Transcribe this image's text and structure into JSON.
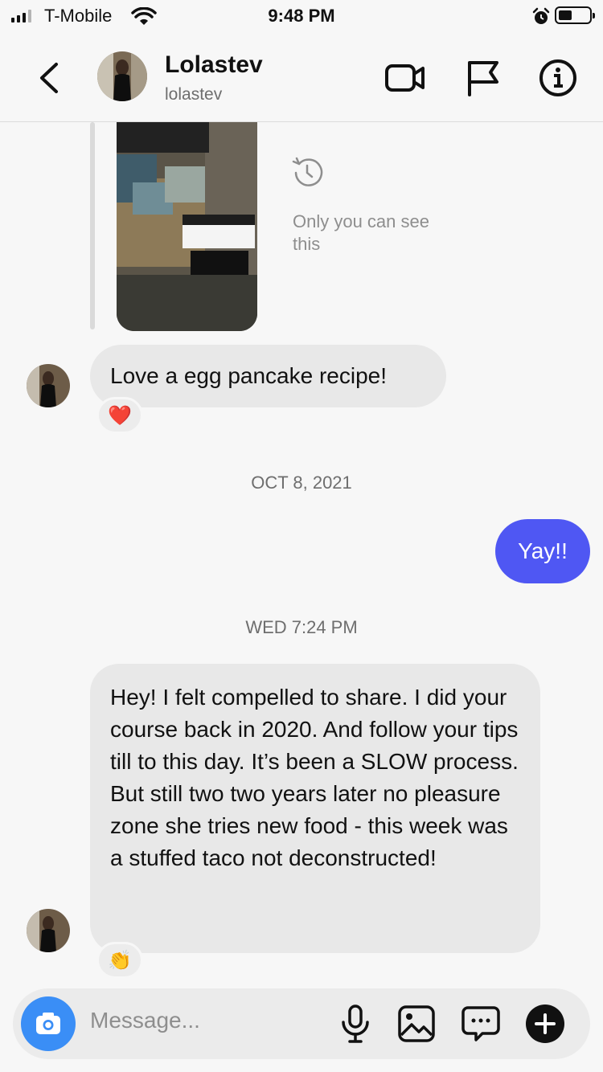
{
  "status_bar": {
    "carrier": "T-Mobile",
    "time": "9:48 PM",
    "icons": [
      "signal-icon",
      "wifi-icon",
      "alarm-icon",
      "battery-icon"
    ]
  },
  "header": {
    "name": "Lolastev",
    "username": "lolastev",
    "icons": [
      "back-icon",
      "video-call-icon",
      "flag-icon",
      "info-icon"
    ]
  },
  "story_reply": {
    "visibility_note": "Only you can see this",
    "icon": "history-icon"
  },
  "messages": [
    {
      "direction": "incoming",
      "text": "Love a egg pancake recipe!",
      "reaction": "❤️"
    },
    {
      "type": "date",
      "text": "OCT 8, 2021"
    },
    {
      "direction": "outgoing",
      "text": "Yay!!"
    },
    {
      "type": "date",
      "text": "WED 7:24 PM"
    },
    {
      "direction": "incoming",
      "text": "Hey! I felt compelled to share. I did your course back in 2020. And follow your tips till to this day. It’s been a SLOW process. But still two two years later no pleasure zone she tries new food - this week was a stuffed taco not deconstructed!",
      "reaction": "👏"
    }
  ],
  "composer": {
    "placeholder": "Message...",
    "icons": [
      "camera-icon",
      "microphone-icon",
      "gallery-icon",
      "sticker-icon",
      "add-icon"
    ]
  },
  "colors": {
    "outgoing_bubble": "#4f57f3",
    "incoming_bubble": "#e8e8e8",
    "camera_button": "#3a8ef6",
    "background": "#f7f7f7"
  }
}
